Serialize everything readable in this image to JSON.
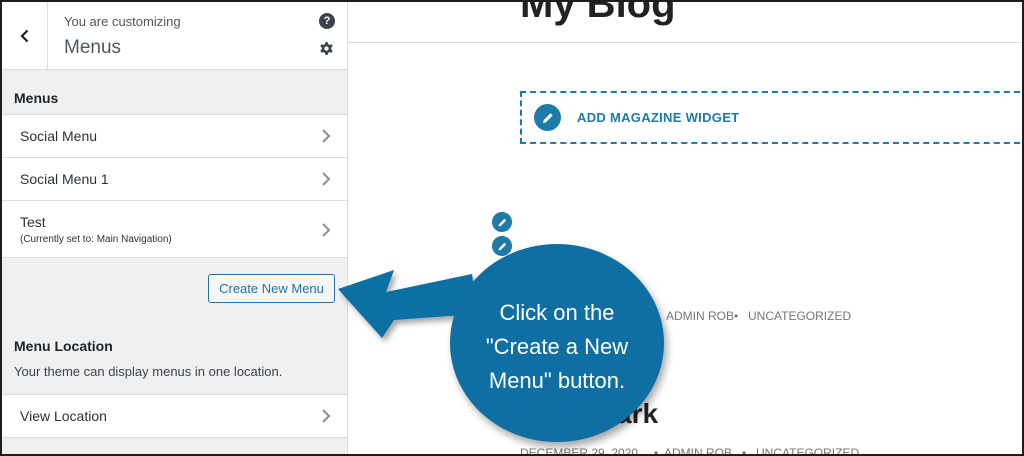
{
  "header": {
    "customizing": "You are customizing",
    "title": "Menus"
  },
  "menus_section": {
    "label": "Menus",
    "items": [
      {
        "label": "Social Menu",
        "sub": ""
      },
      {
        "label": "Social Menu 1",
        "sub": ""
      },
      {
        "label": "Test",
        "sub": "(Currently set to: Main Navigation)"
      }
    ],
    "create_button": "Create New Menu"
  },
  "location_section": {
    "label": "Menu Location",
    "description": "Your theme can display menus in one location.",
    "view_location": "View Location"
  },
  "preview": {
    "blog_title": "My Blog",
    "widget_label": "ADD MAGAZINE WIDGET",
    "meta1": "ADMIN ROB",
    "meta1_cat": "UNCATEGORIZED",
    "post_title_fragment": "ark",
    "meta2_date": "DECEMBER 29, 2020",
    "meta2_author": "ADMIN ROB",
    "meta2_cat": "UNCATEGORIZED",
    "bullet": "•"
  },
  "callout": {
    "line1": "Click on the",
    "line2": "\"Create a New",
    "line3": "Menu\" button."
  },
  "colors": {
    "accent": "#2271b1",
    "callout": "#0f6fa3",
    "preview_accent": "#1e7aa8"
  }
}
